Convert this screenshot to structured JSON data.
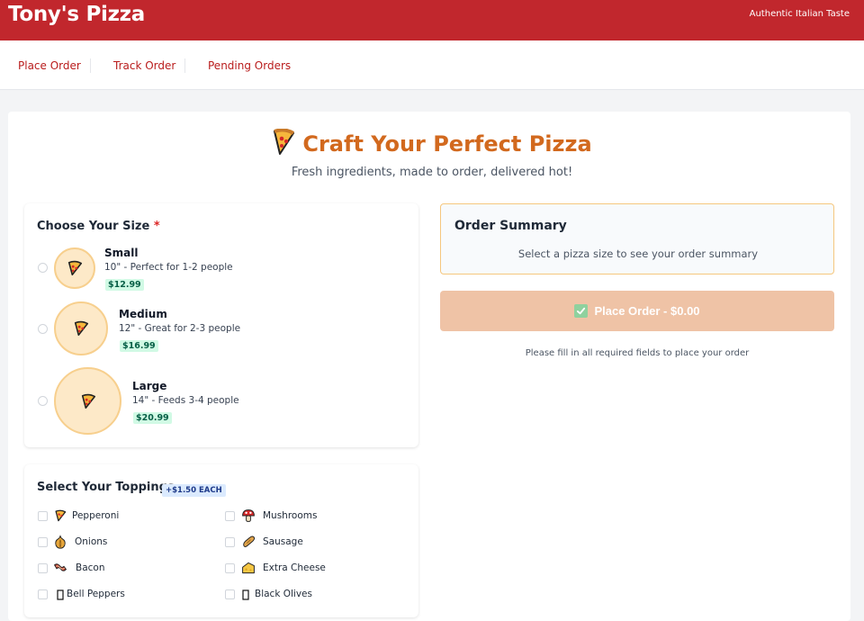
{
  "header": {
    "brand": "Tony's Pizza",
    "tagline": "Authentic Italian Taste"
  },
  "nav": {
    "items": [
      {
        "label": "Place Order"
      },
      {
        "label": "Track Order"
      },
      {
        "label": "Pending Orders"
      }
    ]
  },
  "hero": {
    "title": "Craft Your Perfect Pizza",
    "subtitle": "Fresh ingredients, made to order, delivered hot!",
    "icon": "pizza-icon"
  },
  "size_section": {
    "title": "Choose Your Size",
    "required_mark": "*",
    "sizes": [
      {
        "name": "Small",
        "desc": "10\" - Perfect for 1-2 people",
        "price": "$12.99",
        "selected": false
      },
      {
        "name": "Medium",
        "desc": "12\" - Great for 2-3 people",
        "price": "$16.99",
        "selected": false
      },
      {
        "name": "Large",
        "desc": "14\" - Feeds 3-4 people",
        "price": "$20.99",
        "selected": false
      }
    ]
  },
  "toppings_section": {
    "title": "Select Your Toppings",
    "badge": "+$1.50 EACH",
    "toppings": [
      {
        "label": "Pepperoni",
        "icon": "pizza-icon",
        "checked": false
      },
      {
        "label": "Mushrooms",
        "icon": "mushroom-icon",
        "checked": false
      },
      {
        "label": "Onions",
        "icon": "onion-icon",
        "checked": false
      },
      {
        "label": "Sausage",
        "icon": "sausage-icon",
        "checked": false
      },
      {
        "label": "Bacon",
        "icon": "bacon-icon",
        "checked": false
      },
      {
        "label": "Extra Cheese",
        "icon": "cheese-icon",
        "checked": false
      },
      {
        "label": "Bell Peppers",
        "icon": "missing-glyph-icon",
        "checked": false
      },
      {
        "label": "Black Olives",
        "icon": "missing-glyph-icon",
        "checked": false
      }
    ]
  },
  "summary": {
    "title": "Order Summary",
    "message": "Select a pizza size to see your order summary"
  },
  "order_button": {
    "label": "Place Order - $0.00",
    "enabled": false
  },
  "helper_text": "Please fill in all required fields to place your order",
  "colors": {
    "brand_red": "#c1272d",
    "accent_orange": "#d2691e",
    "button_disabled": "#efc3a6",
    "size_circle": "#fde9c8",
    "price_badge": "#d1fae5",
    "topping_badge": "#dbeafe"
  }
}
